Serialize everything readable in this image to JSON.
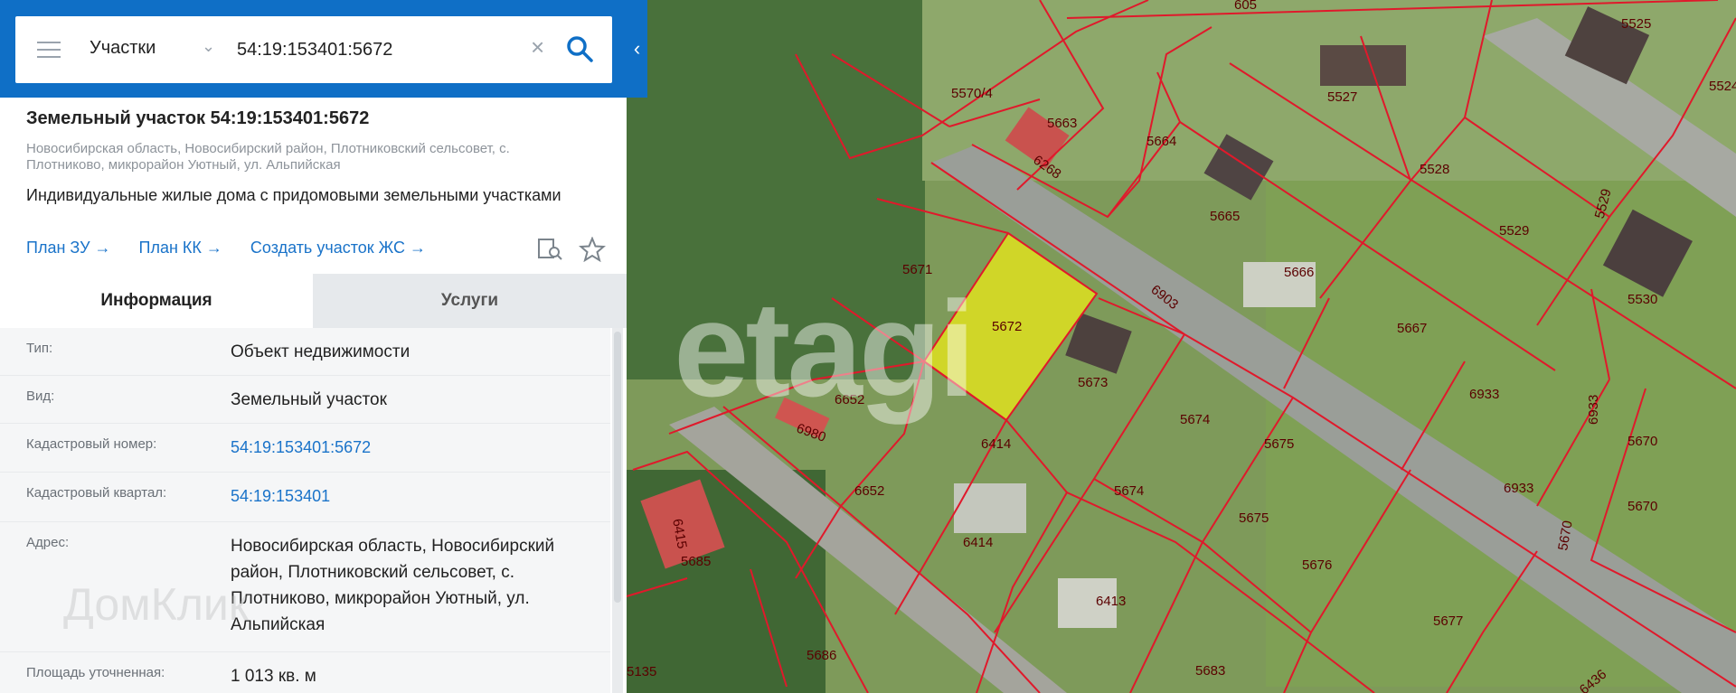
{
  "search": {
    "layer": "Участки",
    "query": "54:19:153401:5672"
  },
  "parcel": {
    "title": "Земельный участок 54:19:153401:5672",
    "address_short": "Новосибирская область, Новосибирский район, Плотниковский сельсовет, с. Плотниково, микрорайон Уютный, ул. Альпийская",
    "purpose": "Индивидуальные жилые дома с придомовыми земельными участками"
  },
  "links": {
    "plan_zu": "План ЗУ →",
    "plan_kk": "План КК →",
    "create": "Создать участок ЖС →"
  },
  "tabs": {
    "info": "Информация",
    "services": "Услуги"
  },
  "info_rows": {
    "type_label": "Тип:",
    "type_value": "Объект недвижимости",
    "kind_label": "Вид:",
    "kind_value": "Земельный участок",
    "cadnum_label": "Кадастровый номер:",
    "cadnum_value": "54:19:153401:5672",
    "quarter_label": "Кадастровый квартал:",
    "quarter_value": "54:19:153401",
    "address_label": "Адрес:",
    "address_value": "Новосибирская область, Новосибирский район, Плотниковский сельсовет, с. Плотниково, микрорайон Уютный, ул. Альпийская",
    "area_label": "Площадь уточненная:",
    "area_value": "1 013 кв. м"
  },
  "watermarks": {
    "etagi": "etagi",
    "domclick": "ДомКлик"
  },
  "map_labels": {
    "l605": "605",
    "l5525": "5525",
    "l5524": "5524",
    "l5570_4": "5570/4",
    "l5663": "5663",
    "l5527": "5527",
    "l5664": "5664",
    "l6268": "6268",
    "l5528": "5528",
    "l5665": "5665",
    "l5529a": "5529",
    "l5529b": "5529",
    "l5671": "5671",
    "l5666": "5666",
    "l6903": "6903",
    "l5530": "5530",
    "l5672": "5672",
    "l5667": "5667",
    "l6652a": "6652",
    "l5673": "5673",
    "l6933a": "6933",
    "l6933b": "6933",
    "l6980": "6980",
    "l5674a": "5674",
    "l6414a": "6414",
    "l5675a": "5675",
    "l5670a": "5670",
    "l6652b": "6652",
    "l5674b": "5674",
    "l6933c": "6933",
    "l5670b": "5670",
    "l6414b": "6414",
    "l5675b": "5675",
    "l5670c": "5670",
    "l5685": "5685",
    "l6415": "6415",
    "l5676": "5676",
    "l6413": "6413",
    "l5677": "5677",
    "l5686": "5686",
    "l5135": "5135",
    "l5683": "5683",
    "l6436": "6436"
  },
  "colors": {
    "brand_blue": "#0f6fc6",
    "parcel_line": "#e0192b",
    "selected_fill": "#e5e51c",
    "link": "#1a73c9"
  }
}
